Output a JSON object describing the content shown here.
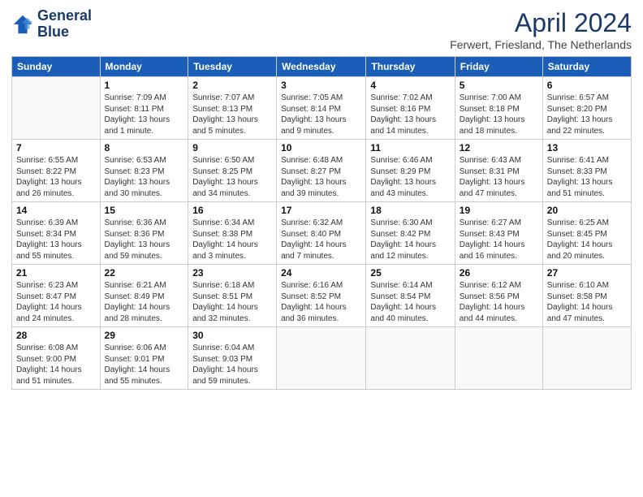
{
  "header": {
    "logo_line1": "General",
    "logo_line2": "Blue",
    "month": "April 2024",
    "location": "Ferwert, Friesland, The Netherlands"
  },
  "days_of_week": [
    "Sunday",
    "Monday",
    "Tuesday",
    "Wednesday",
    "Thursday",
    "Friday",
    "Saturday"
  ],
  "weeks": [
    [
      {
        "num": "",
        "sunrise": "",
        "sunset": "",
        "daylight": ""
      },
      {
        "num": "1",
        "sunrise": "Sunrise: 7:09 AM",
        "sunset": "Sunset: 8:11 PM",
        "daylight": "Daylight: 13 hours and 1 minute."
      },
      {
        "num": "2",
        "sunrise": "Sunrise: 7:07 AM",
        "sunset": "Sunset: 8:13 PM",
        "daylight": "Daylight: 13 hours and 5 minutes."
      },
      {
        "num": "3",
        "sunrise": "Sunrise: 7:05 AM",
        "sunset": "Sunset: 8:14 PM",
        "daylight": "Daylight: 13 hours and 9 minutes."
      },
      {
        "num": "4",
        "sunrise": "Sunrise: 7:02 AM",
        "sunset": "Sunset: 8:16 PM",
        "daylight": "Daylight: 13 hours and 14 minutes."
      },
      {
        "num": "5",
        "sunrise": "Sunrise: 7:00 AM",
        "sunset": "Sunset: 8:18 PM",
        "daylight": "Daylight: 13 hours and 18 minutes."
      },
      {
        "num": "6",
        "sunrise": "Sunrise: 6:57 AM",
        "sunset": "Sunset: 8:20 PM",
        "daylight": "Daylight: 13 hours and 22 minutes."
      }
    ],
    [
      {
        "num": "7",
        "sunrise": "Sunrise: 6:55 AM",
        "sunset": "Sunset: 8:22 PM",
        "daylight": "Daylight: 13 hours and 26 minutes."
      },
      {
        "num": "8",
        "sunrise": "Sunrise: 6:53 AM",
        "sunset": "Sunset: 8:23 PM",
        "daylight": "Daylight: 13 hours and 30 minutes."
      },
      {
        "num": "9",
        "sunrise": "Sunrise: 6:50 AM",
        "sunset": "Sunset: 8:25 PM",
        "daylight": "Daylight: 13 hours and 34 minutes."
      },
      {
        "num": "10",
        "sunrise": "Sunrise: 6:48 AM",
        "sunset": "Sunset: 8:27 PM",
        "daylight": "Daylight: 13 hours and 39 minutes."
      },
      {
        "num": "11",
        "sunrise": "Sunrise: 6:46 AM",
        "sunset": "Sunset: 8:29 PM",
        "daylight": "Daylight: 13 hours and 43 minutes."
      },
      {
        "num": "12",
        "sunrise": "Sunrise: 6:43 AM",
        "sunset": "Sunset: 8:31 PM",
        "daylight": "Daylight: 13 hours and 47 minutes."
      },
      {
        "num": "13",
        "sunrise": "Sunrise: 6:41 AM",
        "sunset": "Sunset: 8:33 PM",
        "daylight": "Daylight: 13 hours and 51 minutes."
      }
    ],
    [
      {
        "num": "14",
        "sunrise": "Sunrise: 6:39 AM",
        "sunset": "Sunset: 8:34 PM",
        "daylight": "Daylight: 13 hours and 55 minutes."
      },
      {
        "num": "15",
        "sunrise": "Sunrise: 6:36 AM",
        "sunset": "Sunset: 8:36 PM",
        "daylight": "Daylight: 13 hours and 59 minutes."
      },
      {
        "num": "16",
        "sunrise": "Sunrise: 6:34 AM",
        "sunset": "Sunset: 8:38 PM",
        "daylight": "Daylight: 14 hours and 3 minutes."
      },
      {
        "num": "17",
        "sunrise": "Sunrise: 6:32 AM",
        "sunset": "Sunset: 8:40 PM",
        "daylight": "Daylight: 14 hours and 7 minutes."
      },
      {
        "num": "18",
        "sunrise": "Sunrise: 6:30 AM",
        "sunset": "Sunset: 8:42 PM",
        "daylight": "Daylight: 14 hours and 12 minutes."
      },
      {
        "num": "19",
        "sunrise": "Sunrise: 6:27 AM",
        "sunset": "Sunset: 8:43 PM",
        "daylight": "Daylight: 14 hours and 16 minutes."
      },
      {
        "num": "20",
        "sunrise": "Sunrise: 6:25 AM",
        "sunset": "Sunset: 8:45 PM",
        "daylight": "Daylight: 14 hours and 20 minutes."
      }
    ],
    [
      {
        "num": "21",
        "sunrise": "Sunrise: 6:23 AM",
        "sunset": "Sunset: 8:47 PM",
        "daylight": "Daylight: 14 hours and 24 minutes."
      },
      {
        "num": "22",
        "sunrise": "Sunrise: 6:21 AM",
        "sunset": "Sunset: 8:49 PM",
        "daylight": "Daylight: 14 hours and 28 minutes."
      },
      {
        "num": "23",
        "sunrise": "Sunrise: 6:18 AM",
        "sunset": "Sunset: 8:51 PM",
        "daylight": "Daylight: 14 hours and 32 minutes."
      },
      {
        "num": "24",
        "sunrise": "Sunrise: 6:16 AM",
        "sunset": "Sunset: 8:52 PM",
        "daylight": "Daylight: 14 hours and 36 minutes."
      },
      {
        "num": "25",
        "sunrise": "Sunrise: 6:14 AM",
        "sunset": "Sunset: 8:54 PM",
        "daylight": "Daylight: 14 hours and 40 minutes."
      },
      {
        "num": "26",
        "sunrise": "Sunrise: 6:12 AM",
        "sunset": "Sunset: 8:56 PM",
        "daylight": "Daylight: 14 hours and 44 minutes."
      },
      {
        "num": "27",
        "sunrise": "Sunrise: 6:10 AM",
        "sunset": "Sunset: 8:58 PM",
        "daylight": "Daylight: 14 hours and 47 minutes."
      }
    ],
    [
      {
        "num": "28",
        "sunrise": "Sunrise: 6:08 AM",
        "sunset": "Sunset: 9:00 PM",
        "daylight": "Daylight: 14 hours and 51 minutes."
      },
      {
        "num": "29",
        "sunrise": "Sunrise: 6:06 AM",
        "sunset": "Sunset: 9:01 PM",
        "daylight": "Daylight: 14 hours and 55 minutes."
      },
      {
        "num": "30",
        "sunrise": "Sunrise: 6:04 AM",
        "sunset": "Sunset: 9:03 PM",
        "daylight": "Daylight: 14 hours and 59 minutes."
      },
      {
        "num": "",
        "sunrise": "",
        "sunset": "",
        "daylight": ""
      },
      {
        "num": "",
        "sunrise": "",
        "sunset": "",
        "daylight": ""
      },
      {
        "num": "",
        "sunrise": "",
        "sunset": "",
        "daylight": ""
      },
      {
        "num": "",
        "sunrise": "",
        "sunset": "",
        "daylight": ""
      }
    ]
  ]
}
